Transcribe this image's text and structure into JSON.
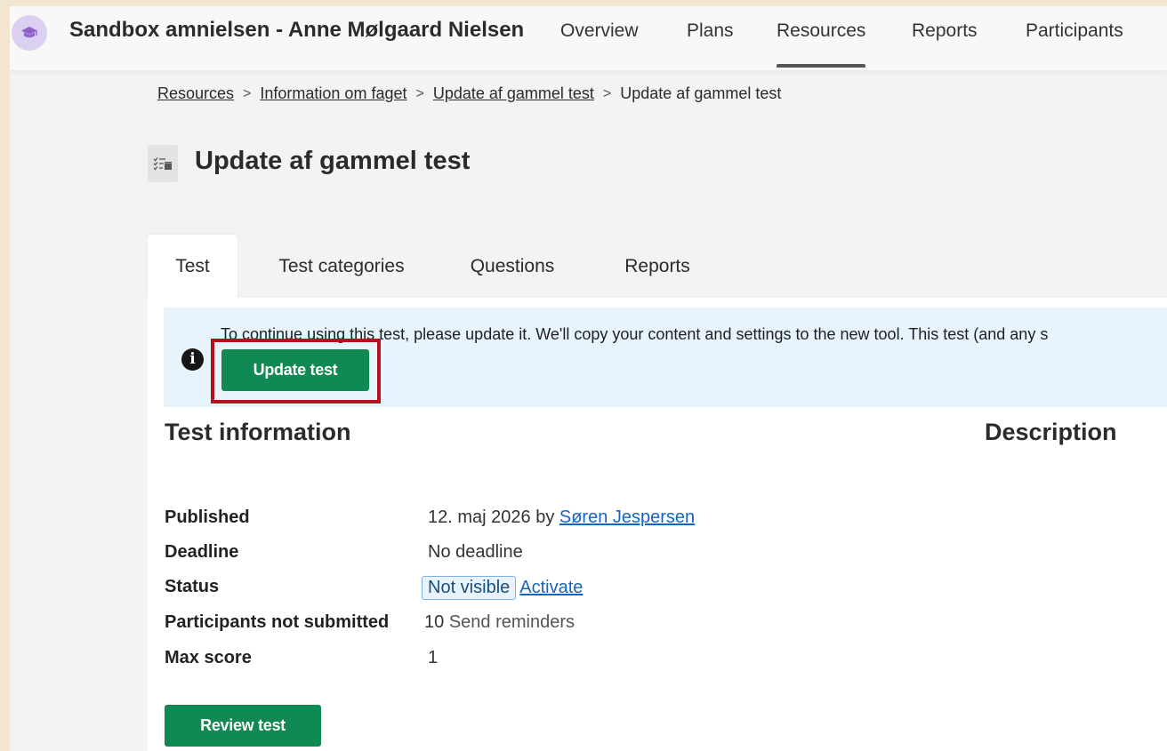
{
  "header": {
    "course_title": "Sandbox amnielsen - Anne Mølgaard Nielsen",
    "nav": [
      {
        "label": "Overview"
      },
      {
        "label": "Plans"
      },
      {
        "label": "Resources",
        "active": true
      },
      {
        "label": "Reports"
      },
      {
        "label": "Participants"
      }
    ]
  },
  "breadcrumb": {
    "items": [
      "Resources",
      "Information om faget",
      "Update af gammel test"
    ],
    "current": "Update af gammel test"
  },
  "page": {
    "title": "Update af gammel test",
    "icon": "test-list-icon"
  },
  "tabs": [
    {
      "label": "Test",
      "active": true
    },
    {
      "label": "Test categories"
    },
    {
      "label": "Questions"
    },
    {
      "label": "Reports"
    }
  ],
  "notice": {
    "text": "To continue using this test, please update it. We'll copy your content and settings to the new tool. This test (and any s",
    "button_label": "Update test"
  },
  "test_info": {
    "heading": "Test information",
    "published_label": "Published",
    "published_value": "12. maj 2026 by ",
    "published_by": "Søren Jespersen",
    "deadline_label": "Deadline",
    "deadline_value": "No deadline",
    "status_label": "Status",
    "status_value": "Not visible",
    "status_action": "Activate",
    "participants_label": "Participants not submitted",
    "participants_count": "10",
    "participants_action": "Send reminders",
    "max_score_label": "Max score",
    "max_score_value": "1"
  },
  "description": {
    "heading": "Description"
  },
  "review_button": "Review test",
  "colors": {
    "accent_green": "#0f8a55",
    "highlight_red": "#b3121c",
    "notice_bg": "#e7f4fc",
    "link_blue": "#1565c0"
  }
}
